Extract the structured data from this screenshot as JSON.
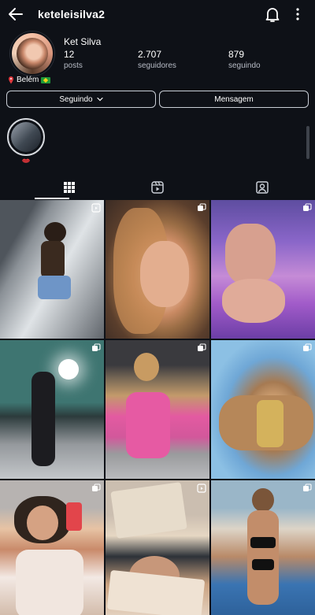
{
  "header": {
    "username": "keteleisilva2",
    "back_icon": "back-arrow-icon",
    "bell_icon": "bell-icon",
    "more_icon": "more-vertical-icon"
  },
  "profile": {
    "display_name": "Ket Silva",
    "stats": [
      {
        "value": "12",
        "label": "posts"
      },
      {
        "value": "2.707",
        "label": "seguidores"
      },
      {
        "value": "879",
        "label": "seguindo"
      }
    ],
    "location": "Belém"
  },
  "actions": {
    "following_label": "Seguindo",
    "message_label": "Mensagem"
  },
  "highlights": [
    {
      "label": ""
    }
  ],
  "tabs": [
    {
      "icon": "grid-icon",
      "active": true
    },
    {
      "icon": "reels-icon",
      "active": false
    },
    {
      "icon": "tagged-icon",
      "active": false
    }
  ],
  "grid": {
    "posts": [
      {
        "badge": "reel-icon"
      },
      {
        "badge": "carousel-icon"
      },
      {
        "badge": "carousel-icon"
      },
      {
        "badge": "carousel-icon"
      },
      {
        "badge": "carousel-icon"
      },
      {
        "badge": "carousel-icon"
      },
      {
        "badge": "carousel-icon"
      },
      {
        "badge": "reel-icon"
      },
      {
        "badge": "carousel-icon"
      }
    ]
  },
  "colors": {
    "background": "#0e1117",
    "text": "#ffffff",
    "muted": "#b7bcc6",
    "border": "#c9ced6",
    "highlight_mark": "#e0393e"
  }
}
